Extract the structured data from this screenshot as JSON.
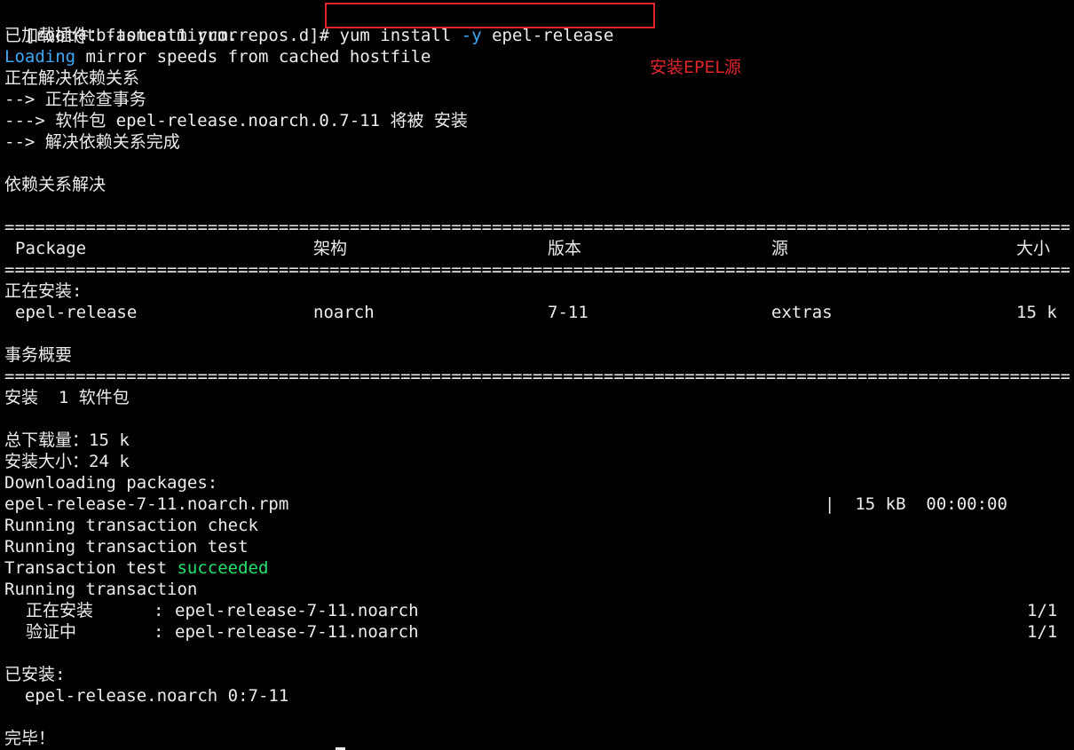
{
  "prompt": "[root@tb-tomcat1 yum.repos.d]# ",
  "command": {
    "prefix": "yum install ",
    "flag": "-y",
    "suffix": " epel-release"
  },
  "annotation": "安装EPEL源",
  "lines": {
    "plugins": "已加载插件：fastestmirror",
    "loading_word": "Loading",
    "loading_rest": " mirror speeds from cached hostfile",
    "resolving": "正在解决依赖关系",
    "checking": "--> 正在检查事务",
    "pkg_install": "---> 软件包 epel-release.noarch.0.7-11 将被 安装",
    "resolve_done": "--> 解决依赖关系完成",
    "deps_resolved": "依赖关系解决",
    "installing_header": "正在安装:",
    "summary_header": "事务概要",
    "install_count": "安装  1 软件包",
    "total_download": "总下载量：15 k",
    "installed_size": "安装大小：24 k",
    "downloading": "Downloading packages:",
    "rpm_file": "epel-release-7-11.noarch.rpm",
    "rpm_progress": "|  15 kB  00:00:00",
    "tx_check": "Running transaction check",
    "tx_test": "Running transaction test",
    "tx_test_result_prefix": "Transaction test ",
    "tx_test_result_word": "succeeded",
    "tx_running": "Running transaction",
    "installed_header": "已安装:",
    "installed_pkg": "  epel-release.noarch 0:7-11",
    "done": "完毕！"
  },
  "separator": "==========================================================================================================================================",
  "table": {
    "headers": [
      "Package",
      "架构",
      "版本",
      "源",
      "大小"
    ],
    "row": [
      "epel-release",
      "noarch",
      "7-11",
      "extras",
      "15 k"
    ]
  },
  "progress_rows": [
    {
      "label": "正在安装",
      "sep": ":",
      "pkg": "epel-release-7-11.noarch",
      "count": "1/1"
    },
    {
      "label": "验证中",
      "sep": ":",
      "pkg": "epel-release-7-11.noarch",
      "count": "1/1"
    }
  ]
}
